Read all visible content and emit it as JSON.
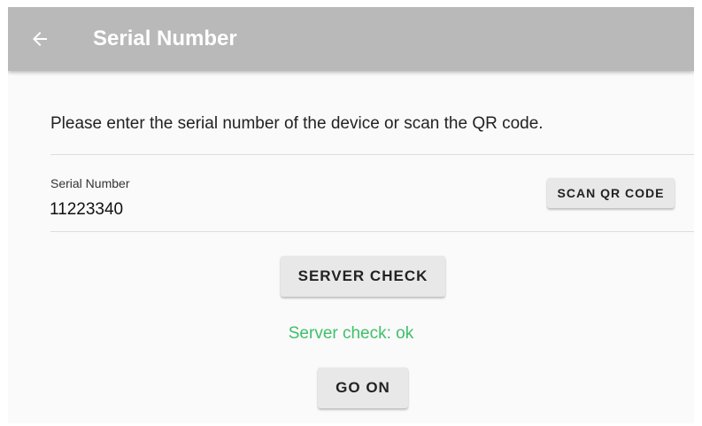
{
  "app_bar": {
    "back_icon": "arrow-left-icon",
    "title": "Serial Number"
  },
  "content": {
    "intro_text": "Please enter the serial number of the device or scan the QR code.",
    "serial_field": {
      "label": "Serial Number",
      "value": "11223340"
    },
    "scan_button_label": "SCAN QR CODE",
    "server_check_button_label": "SERVER CHECK",
    "server_status_text": "Server check: ok",
    "go_on_button_label": "GO ON"
  },
  "colors": {
    "app_bar_background": "#b9b9b9",
    "status_ok": "#3fbf6a",
    "button_background": "#e8e8e8"
  }
}
